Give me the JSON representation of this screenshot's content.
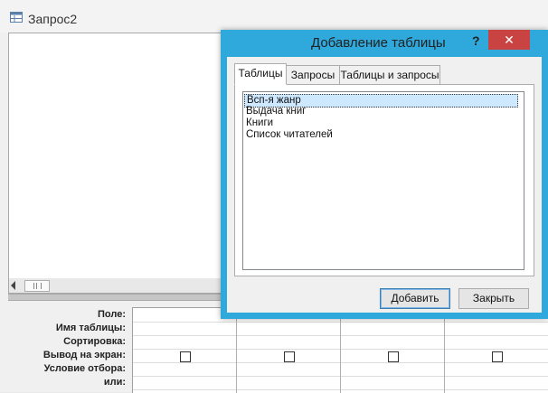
{
  "query_window": {
    "title": "Запрос2"
  },
  "design_grid": {
    "row_labels": [
      "Поле:",
      "Имя таблицы:",
      "Сортировка:",
      "Вывод на экран:",
      "Условие отбора:",
      "или:"
    ]
  },
  "dialog": {
    "title": "Добавление таблицы",
    "help_label": "?",
    "close_label": "✕",
    "tabs": [
      {
        "label": "Таблицы",
        "active": true
      },
      {
        "label": "Запросы",
        "active": false
      },
      {
        "label": "Таблицы и запросы",
        "active": false
      }
    ],
    "tables": [
      {
        "label": "Всп-я жанр",
        "selected": true
      },
      {
        "label": "Выдача книг",
        "selected": false
      },
      {
        "label": "Книги",
        "selected": false
      },
      {
        "label": "Список читателей",
        "selected": false
      }
    ],
    "add_button": "Добавить",
    "close_button": "Закрыть"
  },
  "colors": {
    "dialog_frame": "#2fa8dc",
    "close_button": "#c84341",
    "selection": "#cde8ff"
  }
}
